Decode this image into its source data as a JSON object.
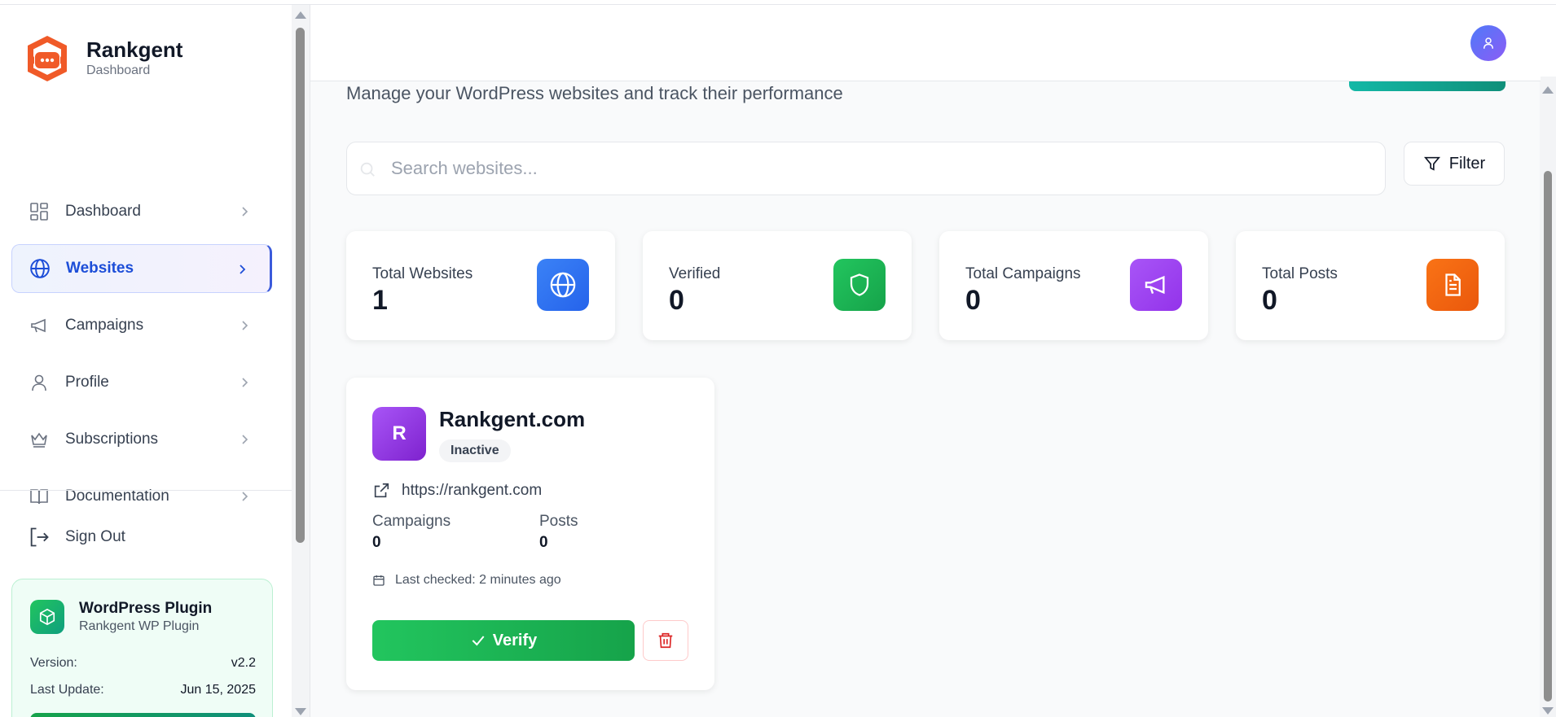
{
  "app": {
    "name": "Rankgent",
    "subtitle": "Dashboard"
  },
  "colors": {
    "accent": "#1d4ed8",
    "logo": "#f05a28",
    "plugin": "#16a34a"
  },
  "sidebar": {
    "items": [
      {
        "label": "Dashboard",
        "icon": "grid-icon",
        "active": false
      },
      {
        "label": "Websites",
        "icon": "globe-icon",
        "active": true
      },
      {
        "label": "Campaigns",
        "icon": "megaphone-icon",
        "active": false
      },
      {
        "label": "Profile",
        "icon": "user-icon",
        "active": false
      },
      {
        "label": "Subscriptions",
        "icon": "crown-icon",
        "active": false
      },
      {
        "label": "Documentation",
        "icon": "book-icon",
        "active": false
      }
    ],
    "sign_out": "Sign Out",
    "plugin": {
      "title": "WordPress Plugin",
      "subtitle": "Rankgent WP Plugin",
      "version_label": "Version:",
      "version_value": "v2.2",
      "update_label": "Last Update:",
      "update_value": "Jun 15, 2025"
    }
  },
  "main": {
    "subtitle": "Manage your WordPress websites and track their performance",
    "search": {
      "placeholder": "Search websites..."
    },
    "filter_label": "Filter",
    "stats": [
      {
        "label": "Total Websites",
        "value": "1",
        "icon": "globe-icon",
        "color": "#2563eb"
      },
      {
        "label": "Verified",
        "value": "0",
        "icon": "shield-icon",
        "color": "#16a34a"
      },
      {
        "label": "Total Campaigns",
        "value": "0",
        "icon": "megaphone-icon",
        "color": "#9333ea"
      },
      {
        "label": "Total Posts",
        "value": "0",
        "icon": "document-icon",
        "color": "#ea580c"
      }
    ],
    "website": {
      "initial": "R",
      "name": "Rankgent.com",
      "status": "Inactive",
      "url": "https://rankgent.com",
      "campaigns_label": "Campaigns",
      "campaigns_value": "0",
      "posts_label": "Posts",
      "posts_value": "0",
      "last_checked": "Last checked: 2 minutes ago",
      "verify_label": "Verify"
    }
  }
}
